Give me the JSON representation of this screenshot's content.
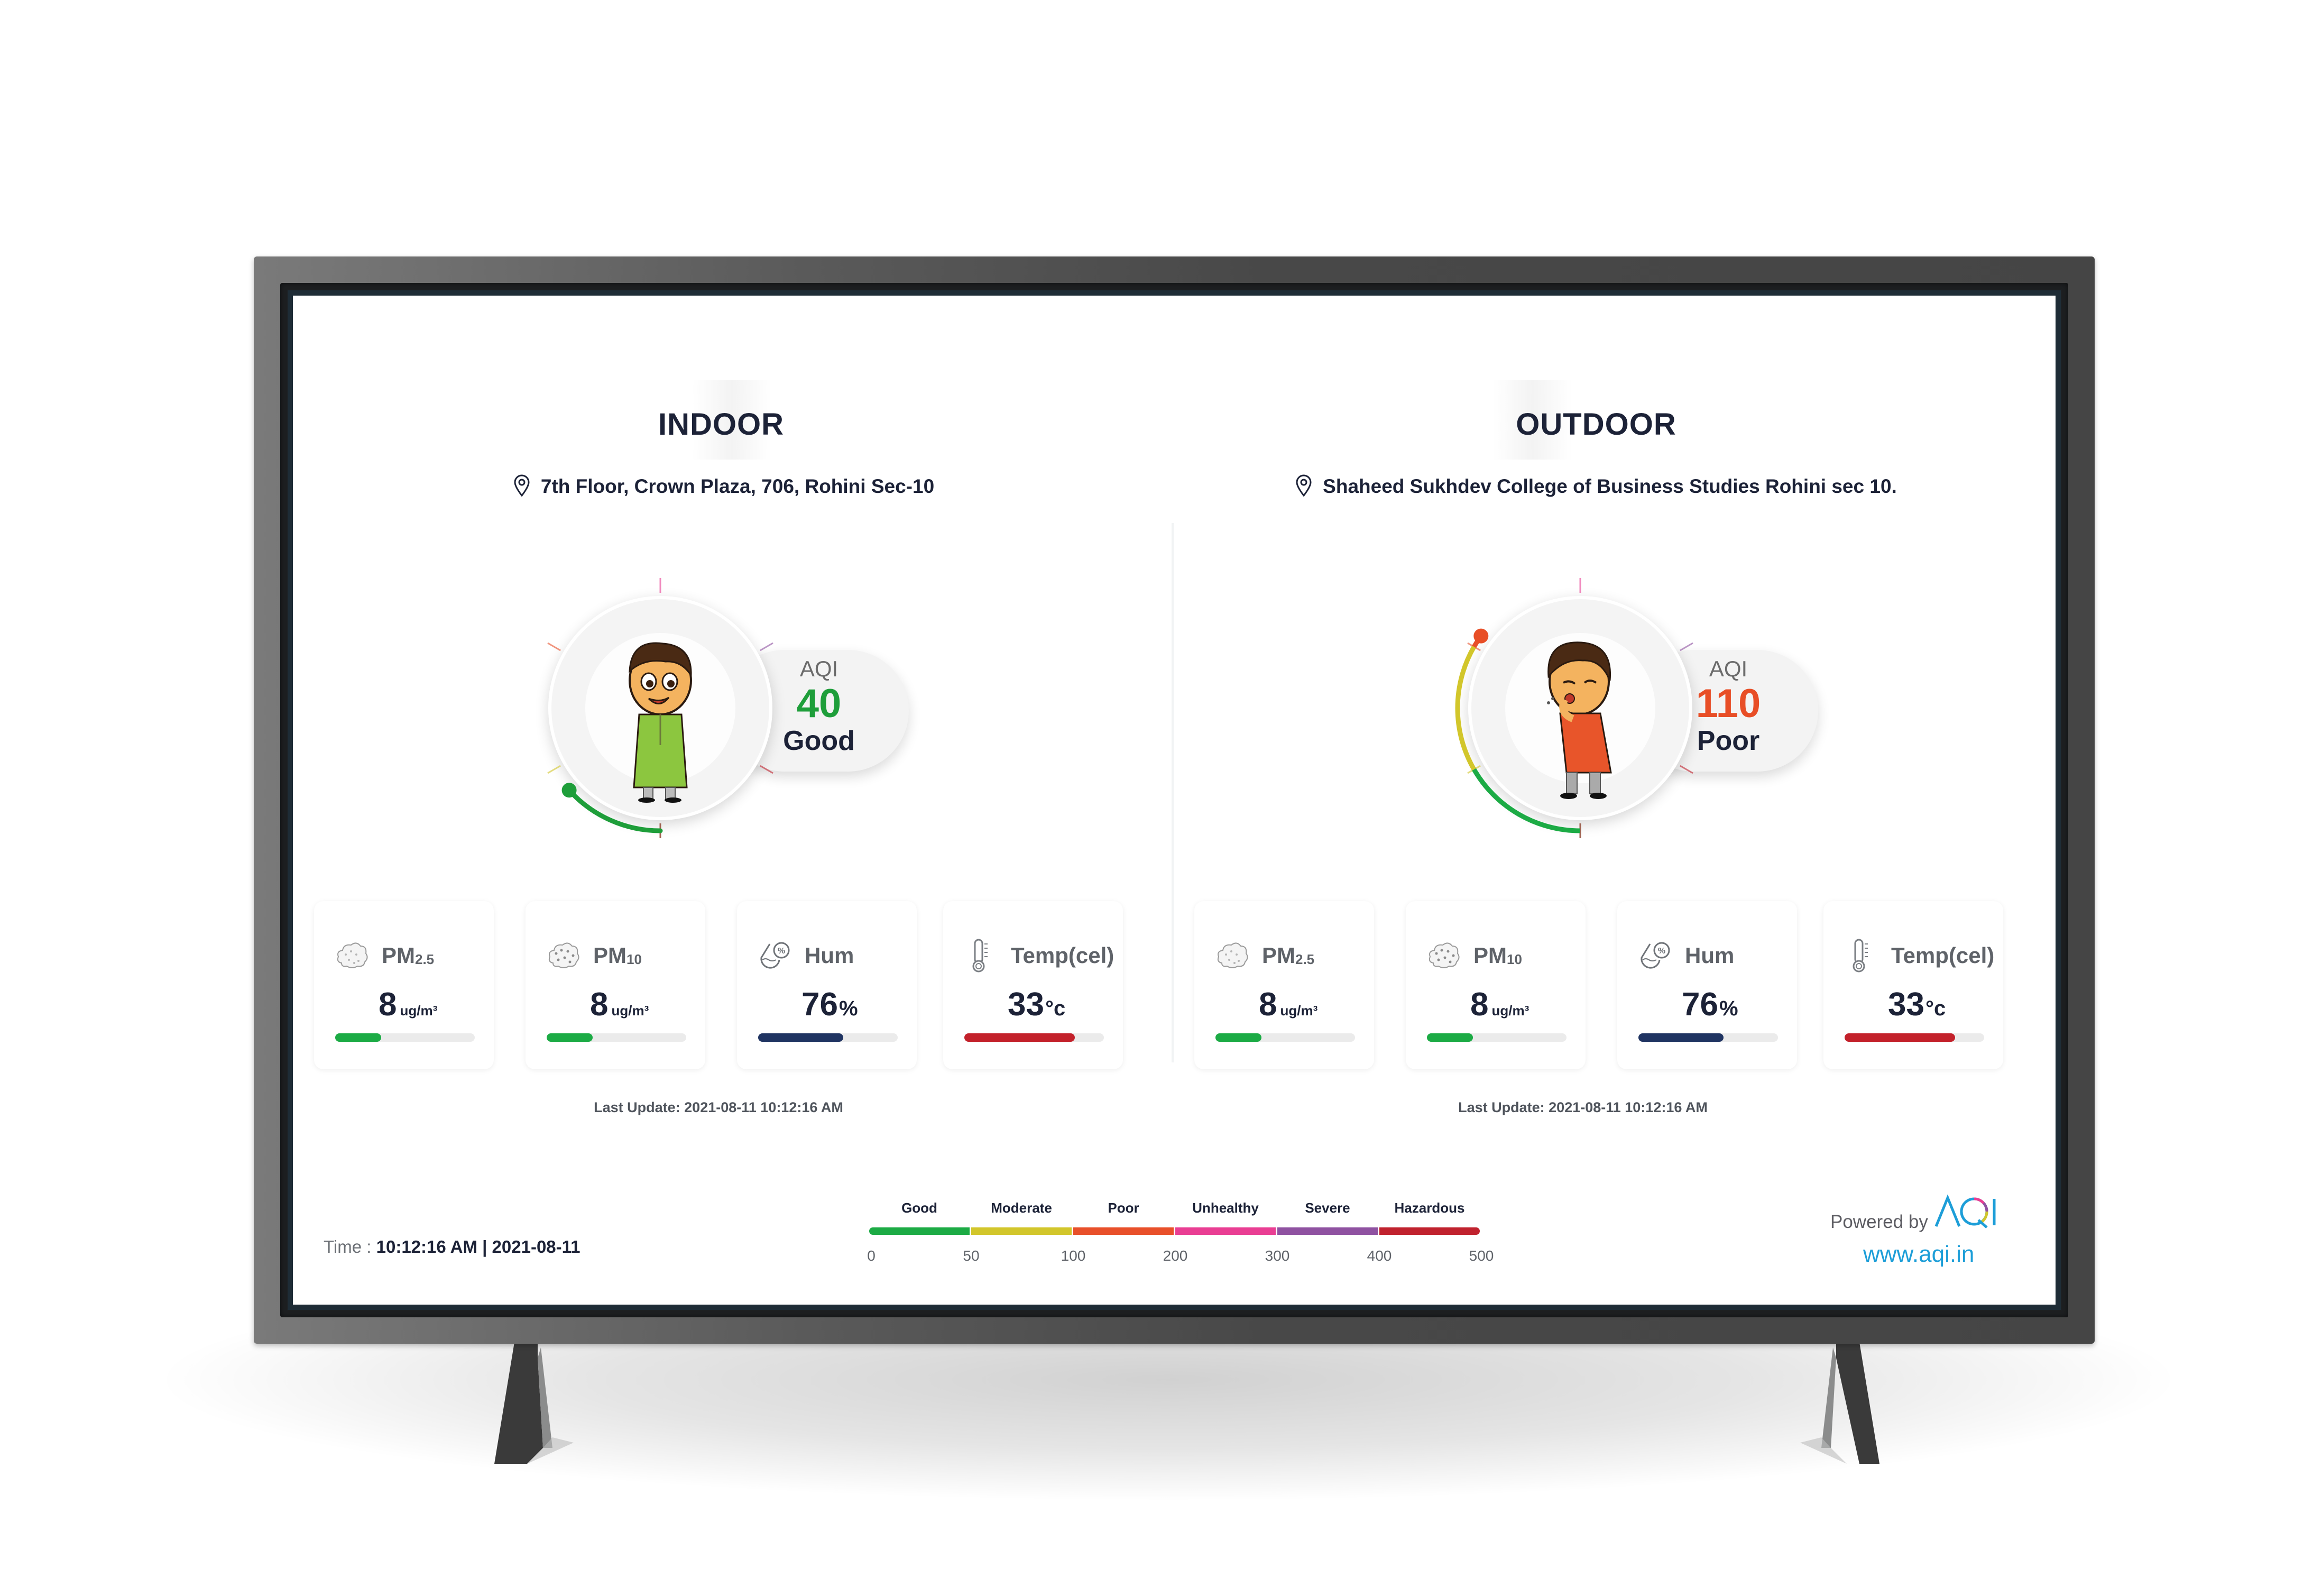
{
  "indoor": {
    "title": "INDOOR",
    "location": "7th Floor, Crown Plaza, 706, Rohini Sec-10",
    "aqi_label": "AQI",
    "aqi_value": "40",
    "aqi_status": "Good",
    "aqi_color": "#1e9e3a",
    "aqi_numeric": 40,
    "metrics": [
      {
        "label": "PM",
        "sub": "2.5",
        "value": "8",
        "unit": "ug/m³",
        "icon": "pm25-cloud-icon",
        "fill_fraction": 0.33,
        "color": "#1cab45"
      },
      {
        "label": "PM",
        "sub": "10",
        "value": "8",
        "unit": "ug/m³",
        "icon": "pm10-cloud-icon",
        "fill_fraction": 0.33,
        "color": "#1cab45"
      },
      {
        "label": "Hum",
        "sub": "",
        "value": "76",
        "unit": "%",
        "icon": "humidity-icon",
        "fill_fraction": 0.61,
        "color": "#203462"
      },
      {
        "label": "Temp(cel)",
        "sub": "",
        "value": "33",
        "unit": "°c",
        "icon": "thermometer-icon",
        "fill_fraction": 0.79,
        "color": "#c3212b"
      }
    ],
    "last_update": "Last Update: 2021-08-11 10:12:16 AM"
  },
  "outdoor": {
    "title": "OUTDOOR",
    "location": "Shaheed Sukhdev College of Business Studies Rohini sec 10.",
    "aqi_label": "AQI",
    "aqi_value": "110",
    "aqi_status": "Poor",
    "aqi_color": "#e84e26",
    "aqi_numeric": 110,
    "metrics": [
      {
        "label": "PM",
        "sub": "2.5",
        "value": "8",
        "unit": "ug/m³",
        "icon": "pm25-cloud-icon",
        "fill_fraction": 0.33,
        "color": "#1cab45"
      },
      {
        "label": "PM",
        "sub": "10",
        "value": "8",
        "unit": "ug/m³",
        "icon": "pm10-cloud-icon",
        "fill_fraction": 0.33,
        "color": "#1cab45"
      },
      {
        "label": "Hum",
        "sub": "",
        "value": "76",
        "unit": "%",
        "icon": "humidity-icon",
        "fill_fraction": 0.61,
        "color": "#203462"
      },
      {
        "label": "Temp(cel)",
        "sub": "",
        "value": "33",
        "unit": "°c",
        "icon": "thermometer-icon",
        "fill_fraction": 0.79,
        "color": "#c3212b"
      }
    ],
    "last_update": "Last Update: 2021-08-11 10:12:16 AM"
  },
  "footer": {
    "time_label": "Time : ",
    "time_value": "10:12:16 AM | 2021-08-11",
    "powered_by": "Powered by",
    "brand": "AQI",
    "url": "www.aqi.in"
  },
  "scale": {
    "categories": [
      {
        "label": "Good",
        "color": "#1cab45"
      },
      {
        "label": "Moderate",
        "color": "#d2c62b"
      },
      {
        "label": "Poor",
        "color": "#e8502a"
      },
      {
        "label": "Unhealthy",
        "color": "#e93e93"
      },
      {
        "label": "Severe",
        "color": "#8f52a1"
      },
      {
        "label": "Hazardous",
        "color": "#c0222e"
      }
    ],
    "ticks": [
      "0",
      "50",
      "100",
      "200",
      "300",
      "400",
      "500"
    ]
  }
}
